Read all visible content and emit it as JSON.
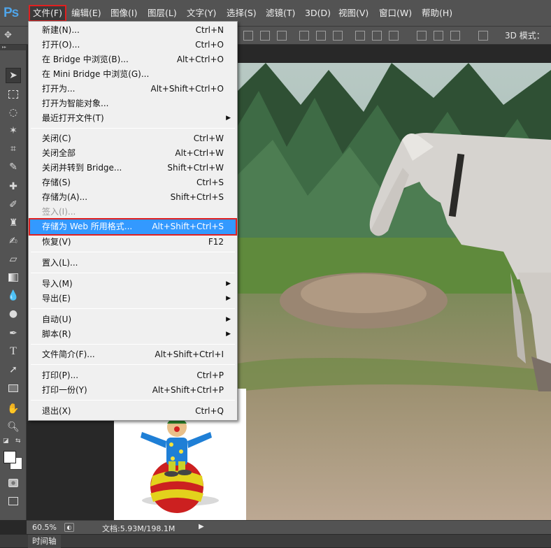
{
  "app": {
    "logo": "Ps"
  },
  "menubar": {
    "items": [
      {
        "label": "文件(F)",
        "active": true
      },
      {
        "label": "编辑(E)"
      },
      {
        "label": "图像(I)"
      },
      {
        "label": "图层(L)"
      },
      {
        "label": "文字(Y)"
      },
      {
        "label": "选择(S)"
      },
      {
        "label": "滤镜(T)"
      },
      {
        "label": "3D(D)"
      },
      {
        "label": "视图(V)"
      },
      {
        "label": "窗口(W)"
      },
      {
        "label": "帮助(H)"
      }
    ]
  },
  "options_bar": {
    "mode_label": "3D 模式："
  },
  "file_menu": {
    "items": [
      {
        "label": "新建(N)...",
        "shortcut": "Ctrl+N"
      },
      {
        "label": "打开(O)...",
        "shortcut": "Ctrl+O"
      },
      {
        "label": "在 Bridge 中浏览(B)...",
        "shortcut": "Alt+Ctrl+O"
      },
      {
        "label": "在 Mini Bridge 中浏览(G)...",
        "shortcut": ""
      },
      {
        "label": "打开为...",
        "shortcut": "Alt+Shift+Ctrl+O"
      },
      {
        "label": "打开为智能对象...",
        "shortcut": ""
      },
      {
        "label": "最近打开文件(T)",
        "shortcut": "",
        "submenu": true
      },
      {
        "label": "关闭(C)",
        "shortcut": "Ctrl+W"
      },
      {
        "label": "关闭全部",
        "shortcut": "Alt+Ctrl+W"
      },
      {
        "label": "关闭并转到 Bridge...",
        "shortcut": "Shift+Ctrl+W"
      },
      {
        "label": "存储(S)",
        "shortcut": "Ctrl+S"
      },
      {
        "label": "存储为(A)...",
        "shortcut": "Shift+Ctrl+S"
      },
      {
        "label": "签入(I)...",
        "shortcut": "",
        "disabled": true
      },
      {
        "label": "存储为 Web 所用格式...",
        "shortcut": "Alt+Shift+Ctrl+S",
        "highlighted": true
      },
      {
        "label": "恢复(V)",
        "shortcut": "F12"
      },
      {
        "label": "置入(L)...",
        "shortcut": ""
      },
      {
        "label": "导入(M)",
        "shortcut": "",
        "submenu": true
      },
      {
        "label": "导出(E)",
        "shortcut": "",
        "submenu": true
      },
      {
        "label": "自动(U)",
        "shortcut": "",
        "submenu": true
      },
      {
        "label": "脚本(R)",
        "shortcut": "",
        "submenu": true
      },
      {
        "label": "文件简介(F)...",
        "shortcut": "Alt+Shift+Ctrl+I"
      },
      {
        "label": "打印(P)...",
        "shortcut": "Ctrl+P"
      },
      {
        "label": "打印一份(Y)",
        "shortcut": "Alt+Shift+Ctrl+P"
      },
      {
        "label": "退出(X)",
        "shortcut": "Ctrl+Q"
      }
    ]
  },
  "status_bar": {
    "zoom": "60.5%",
    "doc_info": "文档:5.93M/198.1M"
  },
  "panels": {
    "timeline_tab": "时间轴"
  },
  "colors": {
    "accent_highlight": "#3399ff",
    "callout_red": "#e02020",
    "ui_gray": "#535353"
  }
}
